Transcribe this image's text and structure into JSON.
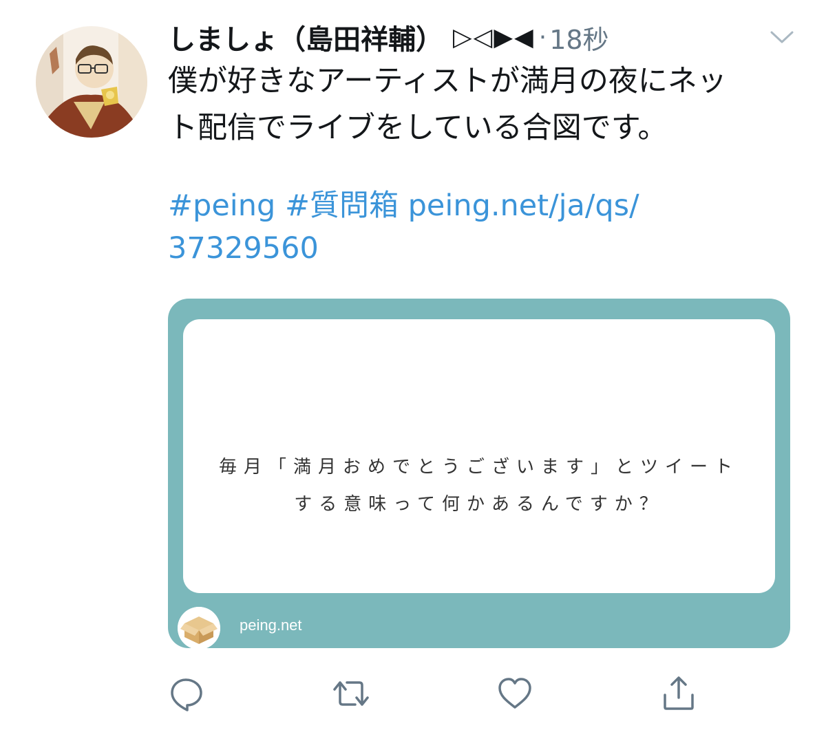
{
  "tweet": {
    "display_name": "しましょ（島田祥輔）",
    "name_symbols": "▷◁▶◀",
    "separator": "·",
    "timestamp": "18秒",
    "text_lines": [
      "僕が好きなアーティストが満月の夜にネッ",
      "ト配信でライブをしている合図です。"
    ],
    "link_lines": [
      "#peing #質問箱 peing.net/ja/qs/",
      "37329560"
    ]
  },
  "card": {
    "question_lines": [
      "毎月「満月おめでとうございます」とツイート",
      "する意味って何かあるんですか？"
    ],
    "site": "peing.net",
    "accent_color": "#7bb8bb"
  },
  "actions": {
    "icons": [
      "reply-icon",
      "retweet-icon",
      "like-icon",
      "share-icon"
    ]
  },
  "colors": {
    "text": "#14171a",
    "secondary": "#657786",
    "link": "#3b94d9"
  }
}
